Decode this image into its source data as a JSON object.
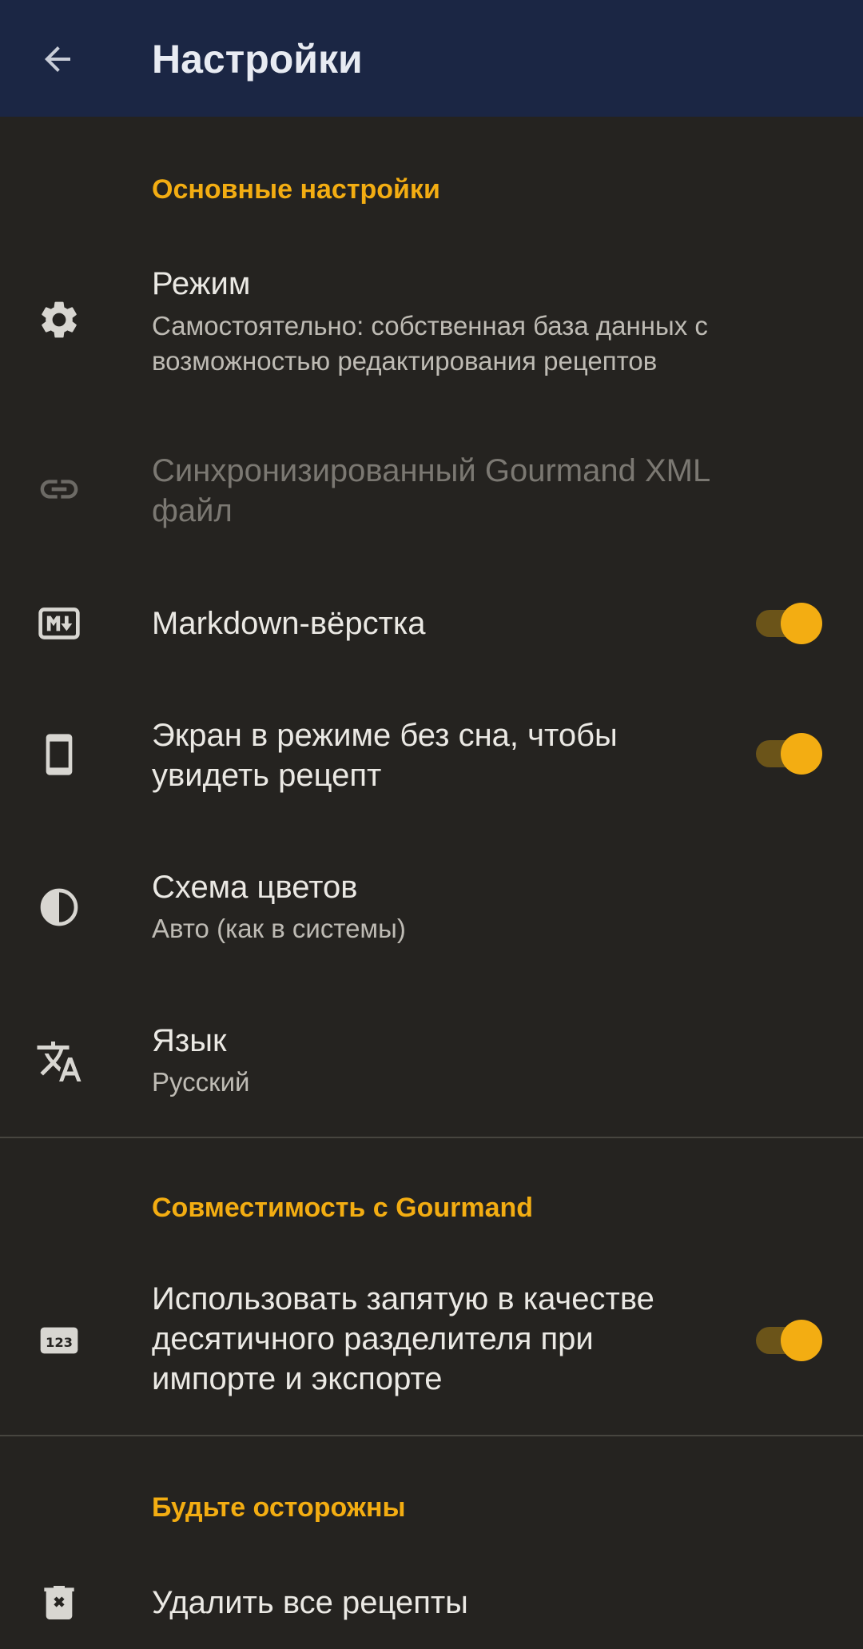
{
  "appbar": {
    "title": "Настройки",
    "back_icon": "arrow-back-icon"
  },
  "colors": {
    "appbar_bg": "#1b2644",
    "background": "#252320",
    "accent": "#f3ad12"
  },
  "sections": {
    "general": {
      "header": "Основные настройки",
      "mode": {
        "icon": "gear-icon",
        "title": "Режим",
        "summary_line1": "Самостоятельно: собственная база данных с",
        "summary_line2": "возможностью редактирования рецептов"
      },
      "sync": {
        "icon": "link-icon",
        "title_line1": "Синхронизированный Gourmand XML",
        "title_line2": "файл",
        "enabled": false
      },
      "markdown": {
        "icon": "markdown-icon",
        "title": "Markdown-вёрстка",
        "checked": true
      },
      "screen": {
        "icon": "phone-icon",
        "title_line1": "Экран в режиме без сна, чтобы",
        "title_line2": "увидеть рецепт",
        "checked": true
      },
      "theme": {
        "icon": "contrast-icon",
        "title": "Схема цветов",
        "summary": "Авто (как в системы)"
      },
      "language": {
        "icon": "translate-icon",
        "title": "Язык",
        "summary": "Русский"
      }
    },
    "compat": {
      "header": "Совместимость с Gourmand",
      "decimal": {
        "icon": "numbers-123-icon",
        "icon_text": "123",
        "title_line1": "Использовать запятую в качестве",
        "title_line2": "десятичного разделителя при",
        "title_line3": "импорте и экспорте",
        "checked": true
      }
    },
    "danger": {
      "header": "Будьте осторожны",
      "delete_all": {
        "icon": "delete-icon",
        "title": "Удалить все рецепты"
      }
    }
  }
}
